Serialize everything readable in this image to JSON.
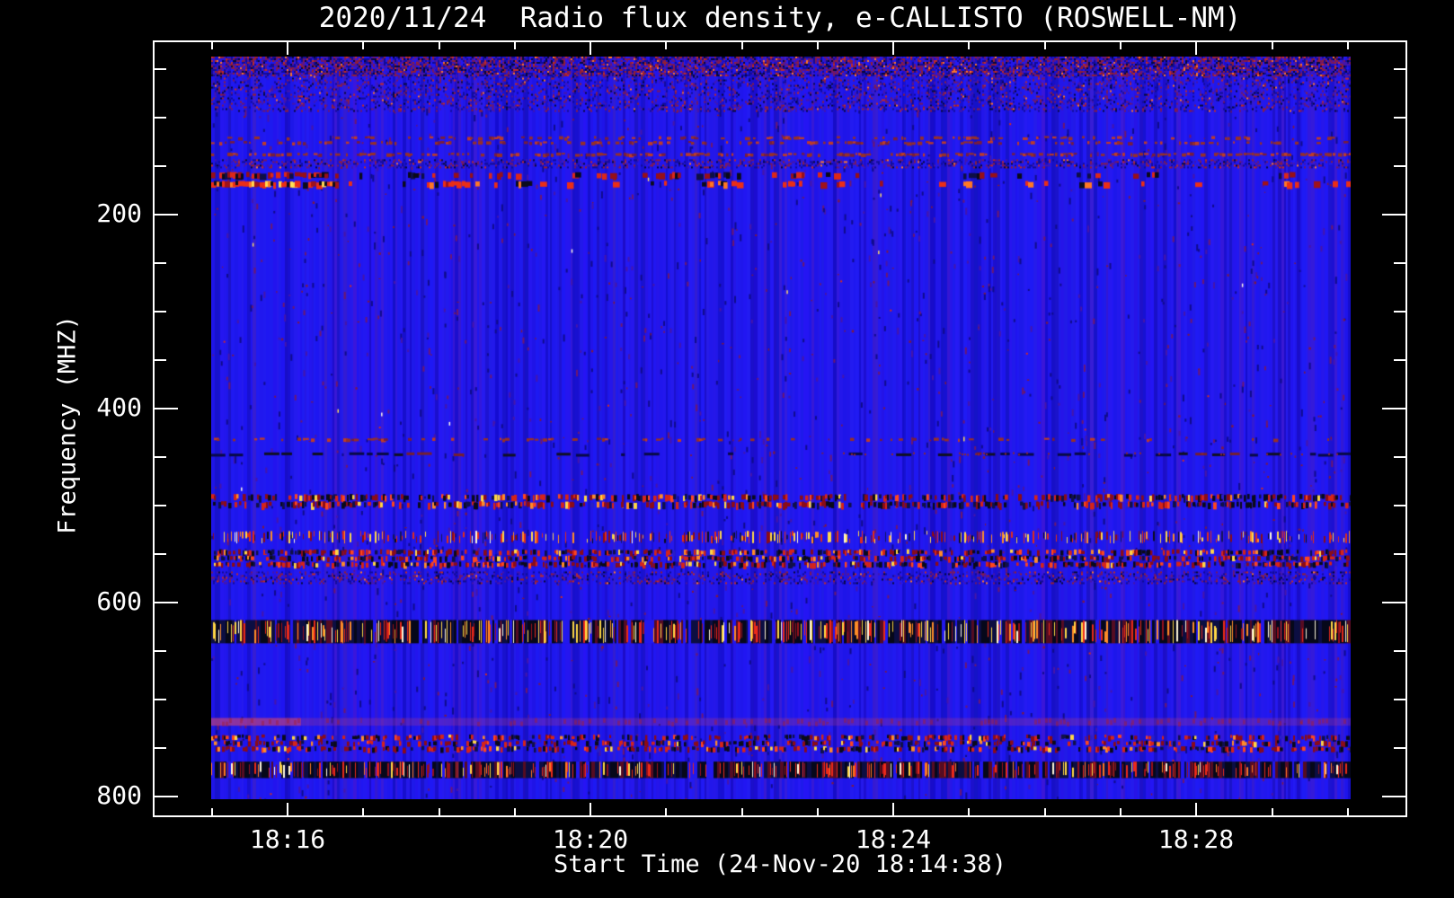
{
  "chart_data": {
    "type": "heatmap",
    "title": "2020/11/24  Radio flux density, e-CALLISTO (ROSWELL-NM)",
    "xlabel": "Start Time (24-Nov-20 18:14:38)",
    "ylabel": "Frequency (MHZ)",
    "instrument": "e-CALLISTO (ROSWELL-NM)",
    "date": "2020/11/24",
    "start_time": "18:14:38",
    "x_axis": {
      "label": "Start Time (24-Nov-20 18:14:38)",
      "major_ticks": [
        {
          "minute": 16,
          "label": "18:16"
        },
        {
          "minute": 20,
          "label": "18:20"
        },
        {
          "minute": 24,
          "label": "18:24"
        },
        {
          "minute": 28,
          "label": "18:28"
        }
      ],
      "minor_step_min": 1,
      "minor_from_min": 15,
      "minor_to_min": 30
    },
    "y_axis": {
      "label": "Frequency (MHZ)",
      "major_ticks": [
        {
          "mhz": 200,
          "label": "200"
        },
        {
          "mhz": 400,
          "label": "400"
        },
        {
          "mhz": 600,
          "label": "600"
        },
        {
          "mhz": 800,
          "label": "800"
        }
      ],
      "minor_step_mhz": 50,
      "minor_from_mhz": 50,
      "minor_to_mhz": 800,
      "top_mhz": 37,
      "bottom_mhz": 803,
      "inverted": true
    },
    "palette": {
      "background": "#000000",
      "axis": "#FFFFFF",
      "base_blue": "#2218EE",
      "dark_navy": "#0A0C3C",
      "near_black": "#050819",
      "dark_red": "#8C0A14",
      "red": "#E02816",
      "orange": "#FF8C28",
      "yellow": "#FFD246",
      "white_hot": "#FFF8DC",
      "smear_magenta": "#B93C78"
    },
    "bands": [
      {
        "f1": 37,
        "f2": 57,
        "type": "mottle",
        "density": 0.72,
        "note": "dense dark/red mottling at top edge"
      },
      {
        "f1": 57,
        "f2": 94,
        "type": "mottle",
        "density": 0.26,
        "note": "medium mottling"
      },
      {
        "f1": 119,
        "f2": 121,
        "type": "dotrow",
        "density": 0.22,
        "note": "sparse red dashes"
      },
      {
        "f1": 124,
        "f2": 127,
        "type": "dotrow",
        "density": 0.3,
        "note": "faint dotted interference line"
      },
      {
        "f1": 136,
        "f2": 140,
        "type": "dotrow",
        "density": 0.45,
        "note": "brownish RFI row"
      },
      {
        "f1": 143,
        "f2": 151,
        "type": "mottle",
        "density": 0.4,
        "note": "faint dark-red band"
      },
      {
        "f1": 156,
        "f2": 163,
        "type": "sparse_dash",
        "density": 0.16,
        "note": "dark red/black segments, strong at left"
      },
      {
        "f1": 165,
        "f2": 172,
        "type": "sparse_dash_bright",
        "density": 0.14,
        "note": "bright red-orange segments, strong at left"
      },
      {
        "f1": 430,
        "f2": 433,
        "type": "dotrow_fade",
        "density": 0.3,
        "note": "faint red dotted line, fading to right"
      },
      {
        "f1": 445,
        "f2": 449,
        "type": "dashrow",
        "density": 0.55,
        "note": "dark navy dashed line"
      },
      {
        "f1": 488,
        "f2": 503,
        "type": "speckle",
        "density": 0.6,
        "note": "dense dark/red speckle band"
      },
      {
        "f1": 526,
        "f2": 539,
        "type": "bright_speckle",
        "density": 0.5,
        "note": "yellow/red speckles on blue"
      },
      {
        "f1": 545,
        "f2": 564,
        "type": "speckle",
        "density": 0.62,
        "note": "dark band with red segments"
      },
      {
        "f1": 568,
        "f2": 580,
        "type": "mottle",
        "density": 0.3,
        "note": "faint purple mottled band"
      },
      {
        "f1": 618,
        "f2": 642,
        "type": "bright_band",
        "density": 0.48,
        "hot": true,
        "note": "strongest RFI band, yellow/white ticks on black"
      },
      {
        "f1": 719,
        "f2": 727,
        "type": "smear",
        "density": 0.3,
        "note": "reddish-purple smear, strongest at left"
      },
      {
        "f1": 736,
        "f2": 754,
        "type": "speckle",
        "density": 0.5,
        "note": "speckled dark/red band"
      },
      {
        "f1": 764,
        "f2": 781,
        "type": "bright_band",
        "density": 0.42,
        "hot": false,
        "note": "strong band, red/white ticks on black"
      }
    ]
  }
}
